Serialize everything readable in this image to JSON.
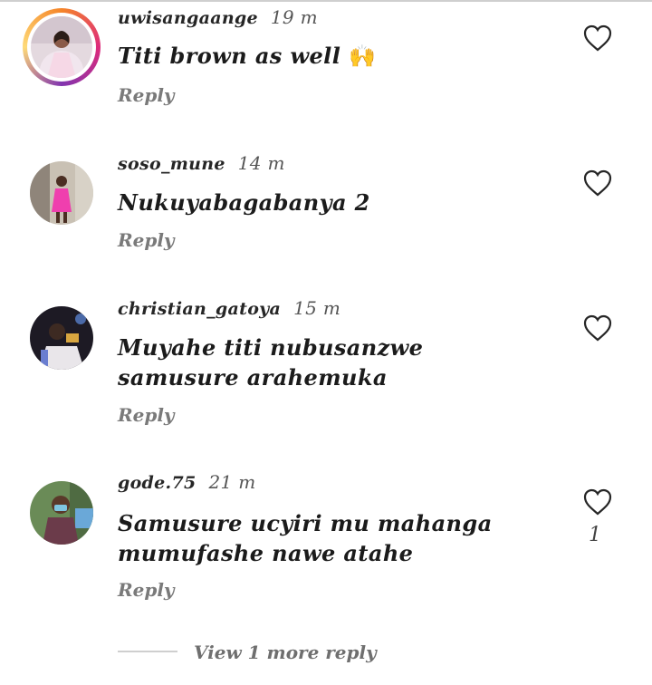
{
  "comments": [
    {
      "username": "uwisangaange",
      "time": "19 m",
      "text": "Titi brown as well",
      "emoji": "🙌",
      "reply_label": "Reply",
      "has_story": true,
      "likes": ""
    },
    {
      "username": "soso_mune",
      "time": "14 m",
      "text": "Nukuyabagabanya 2",
      "reply_label": "Reply",
      "has_story": false,
      "likes": ""
    },
    {
      "username": "christian_gatoya",
      "time": "15 m",
      "text": "Muyahe titi nubusanzwe samusure arahemuka",
      "reply_label": "Reply",
      "has_story": false,
      "likes": ""
    },
    {
      "username": "gode.75",
      "time": "21 m",
      "text": "Samusure  ucyiri  mu mahanga mumufashe nawe atahe",
      "reply_label": "Reply",
      "has_story": false,
      "likes": "1"
    }
  ],
  "view_more_label": "View 1 more reply",
  "colors": {
    "heart_stroke": "#262626",
    "reply": "#7a7a7a",
    "divider": "#cfcfcf"
  },
  "icons": [
    "heart-outline-icon",
    "raising-hands-emoji"
  ]
}
